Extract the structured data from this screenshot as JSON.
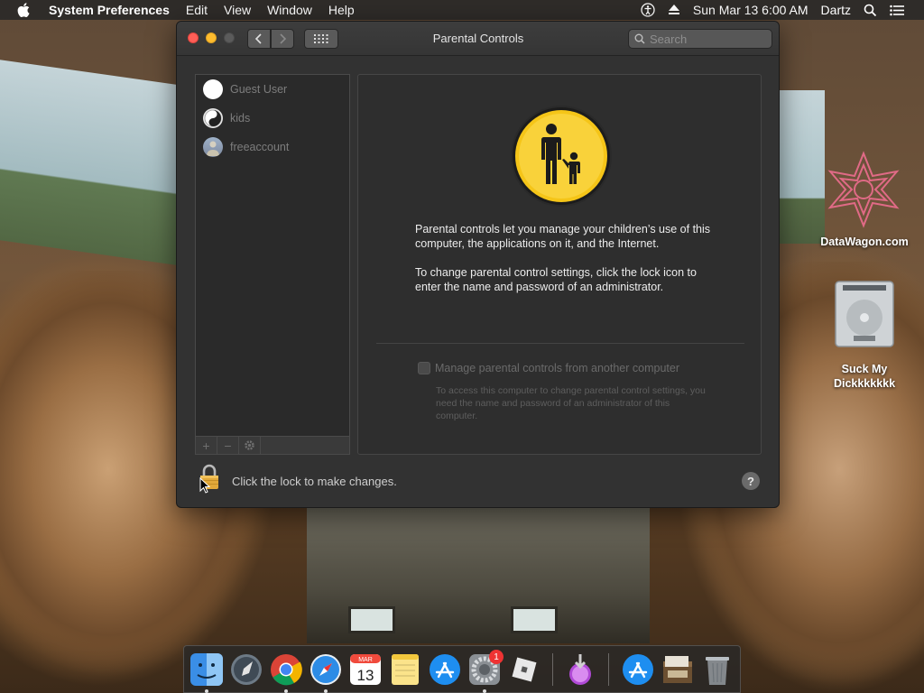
{
  "menubar": {
    "app_name": "System Preferences",
    "menus": [
      "Edit",
      "View",
      "Window",
      "Help"
    ],
    "datetime": "Sun Mar 13  6:00 AM",
    "user": "Dartz"
  },
  "window": {
    "title": "Parental Controls",
    "search_placeholder": "Search"
  },
  "users": [
    {
      "name": "Guest User"
    },
    {
      "name": "kids"
    },
    {
      "name": "freeaccount"
    }
  ],
  "list_toolbar": {
    "add": "+",
    "remove": "−"
  },
  "main": {
    "description_1": "Parental controls let you manage your children’s use of this computer, the applications on it, and the Internet.",
    "description_2": "To change parental control settings, click the lock icon to enter the name and password of an administrator.",
    "remote_label": "Manage parental controls from another computer",
    "remote_desc": "To access this computer to change parental control settings, you need the name and password of an administrator of this computer."
  },
  "footer": {
    "lock_text": "Click the lock to make changes.",
    "help": "?"
  },
  "desktop": {
    "icon1_label": "DataWagon.com",
    "icon2_label": "Suck My Dickkkkkkk"
  },
  "dock": {
    "calendar_month": "MAR",
    "calendar_day": "13",
    "prefs_badge": "1"
  },
  "colors": {
    "close": "#ff5f57",
    "minimize": "#febc2e",
    "pc_icon_yellow": "#f5c518"
  }
}
